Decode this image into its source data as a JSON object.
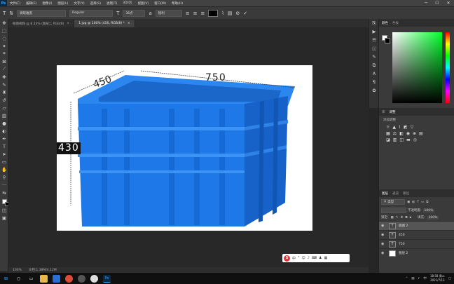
{
  "app": {
    "logo": "Ps"
  },
  "menu": [
    "文件(F)",
    "编辑(E)",
    "图像(I)",
    "图层(L)",
    "文字(Y)",
    "选择(S)",
    "滤镜(T)",
    "3D(D)",
    "视图(V)",
    "窗口(W)",
    "帮助(H)"
  ],
  "options": {
    "font_family": "微软雅黑",
    "font_style": "Regular",
    "font_size": "36点",
    "aa": "锐利"
  },
  "tabs": [
    "抠图视频 @ 8.33% (图层1, RGB/8)",
    "1.jpg @ 100% (450, RGB/8) *"
  ],
  "doc": {
    "dim_width": "450",
    "dim_length": "750",
    "dim_height": "430"
  },
  "status": {
    "zoom": "100%",
    "info": "文档:1.38M/4.12M"
  },
  "panels": {
    "color_tabs": [
      "颜色",
      "色板"
    ],
    "adjust_tabs": [
      "库",
      "调整"
    ],
    "adjust_title": "添加调整",
    "layer_tabs": [
      "图层",
      "通道",
      "路径"
    ],
    "kind": "类型",
    "opacity_label": "不透明度:",
    "opacity": "100%",
    "fill_label": "填充:",
    "fill": "100%",
    "lock_label": "锁定:"
  },
  "layers": [
    {
      "name": "底图 2",
      "selected": true
    },
    {
      "name": "450",
      "selected": false
    },
    {
      "name": "750",
      "selected": false
    },
    {
      "name": "图层 2",
      "selected": false
    }
  ],
  "ime": {
    "brand": "S",
    "mode": "中"
  },
  "clock": {
    "time": "18:58 周二",
    "date": "2021/7/13"
  },
  "colors": {
    "crate": "#1e78e8",
    "canvas_bg": "#282828",
    "panel": "#3a3a3a"
  }
}
